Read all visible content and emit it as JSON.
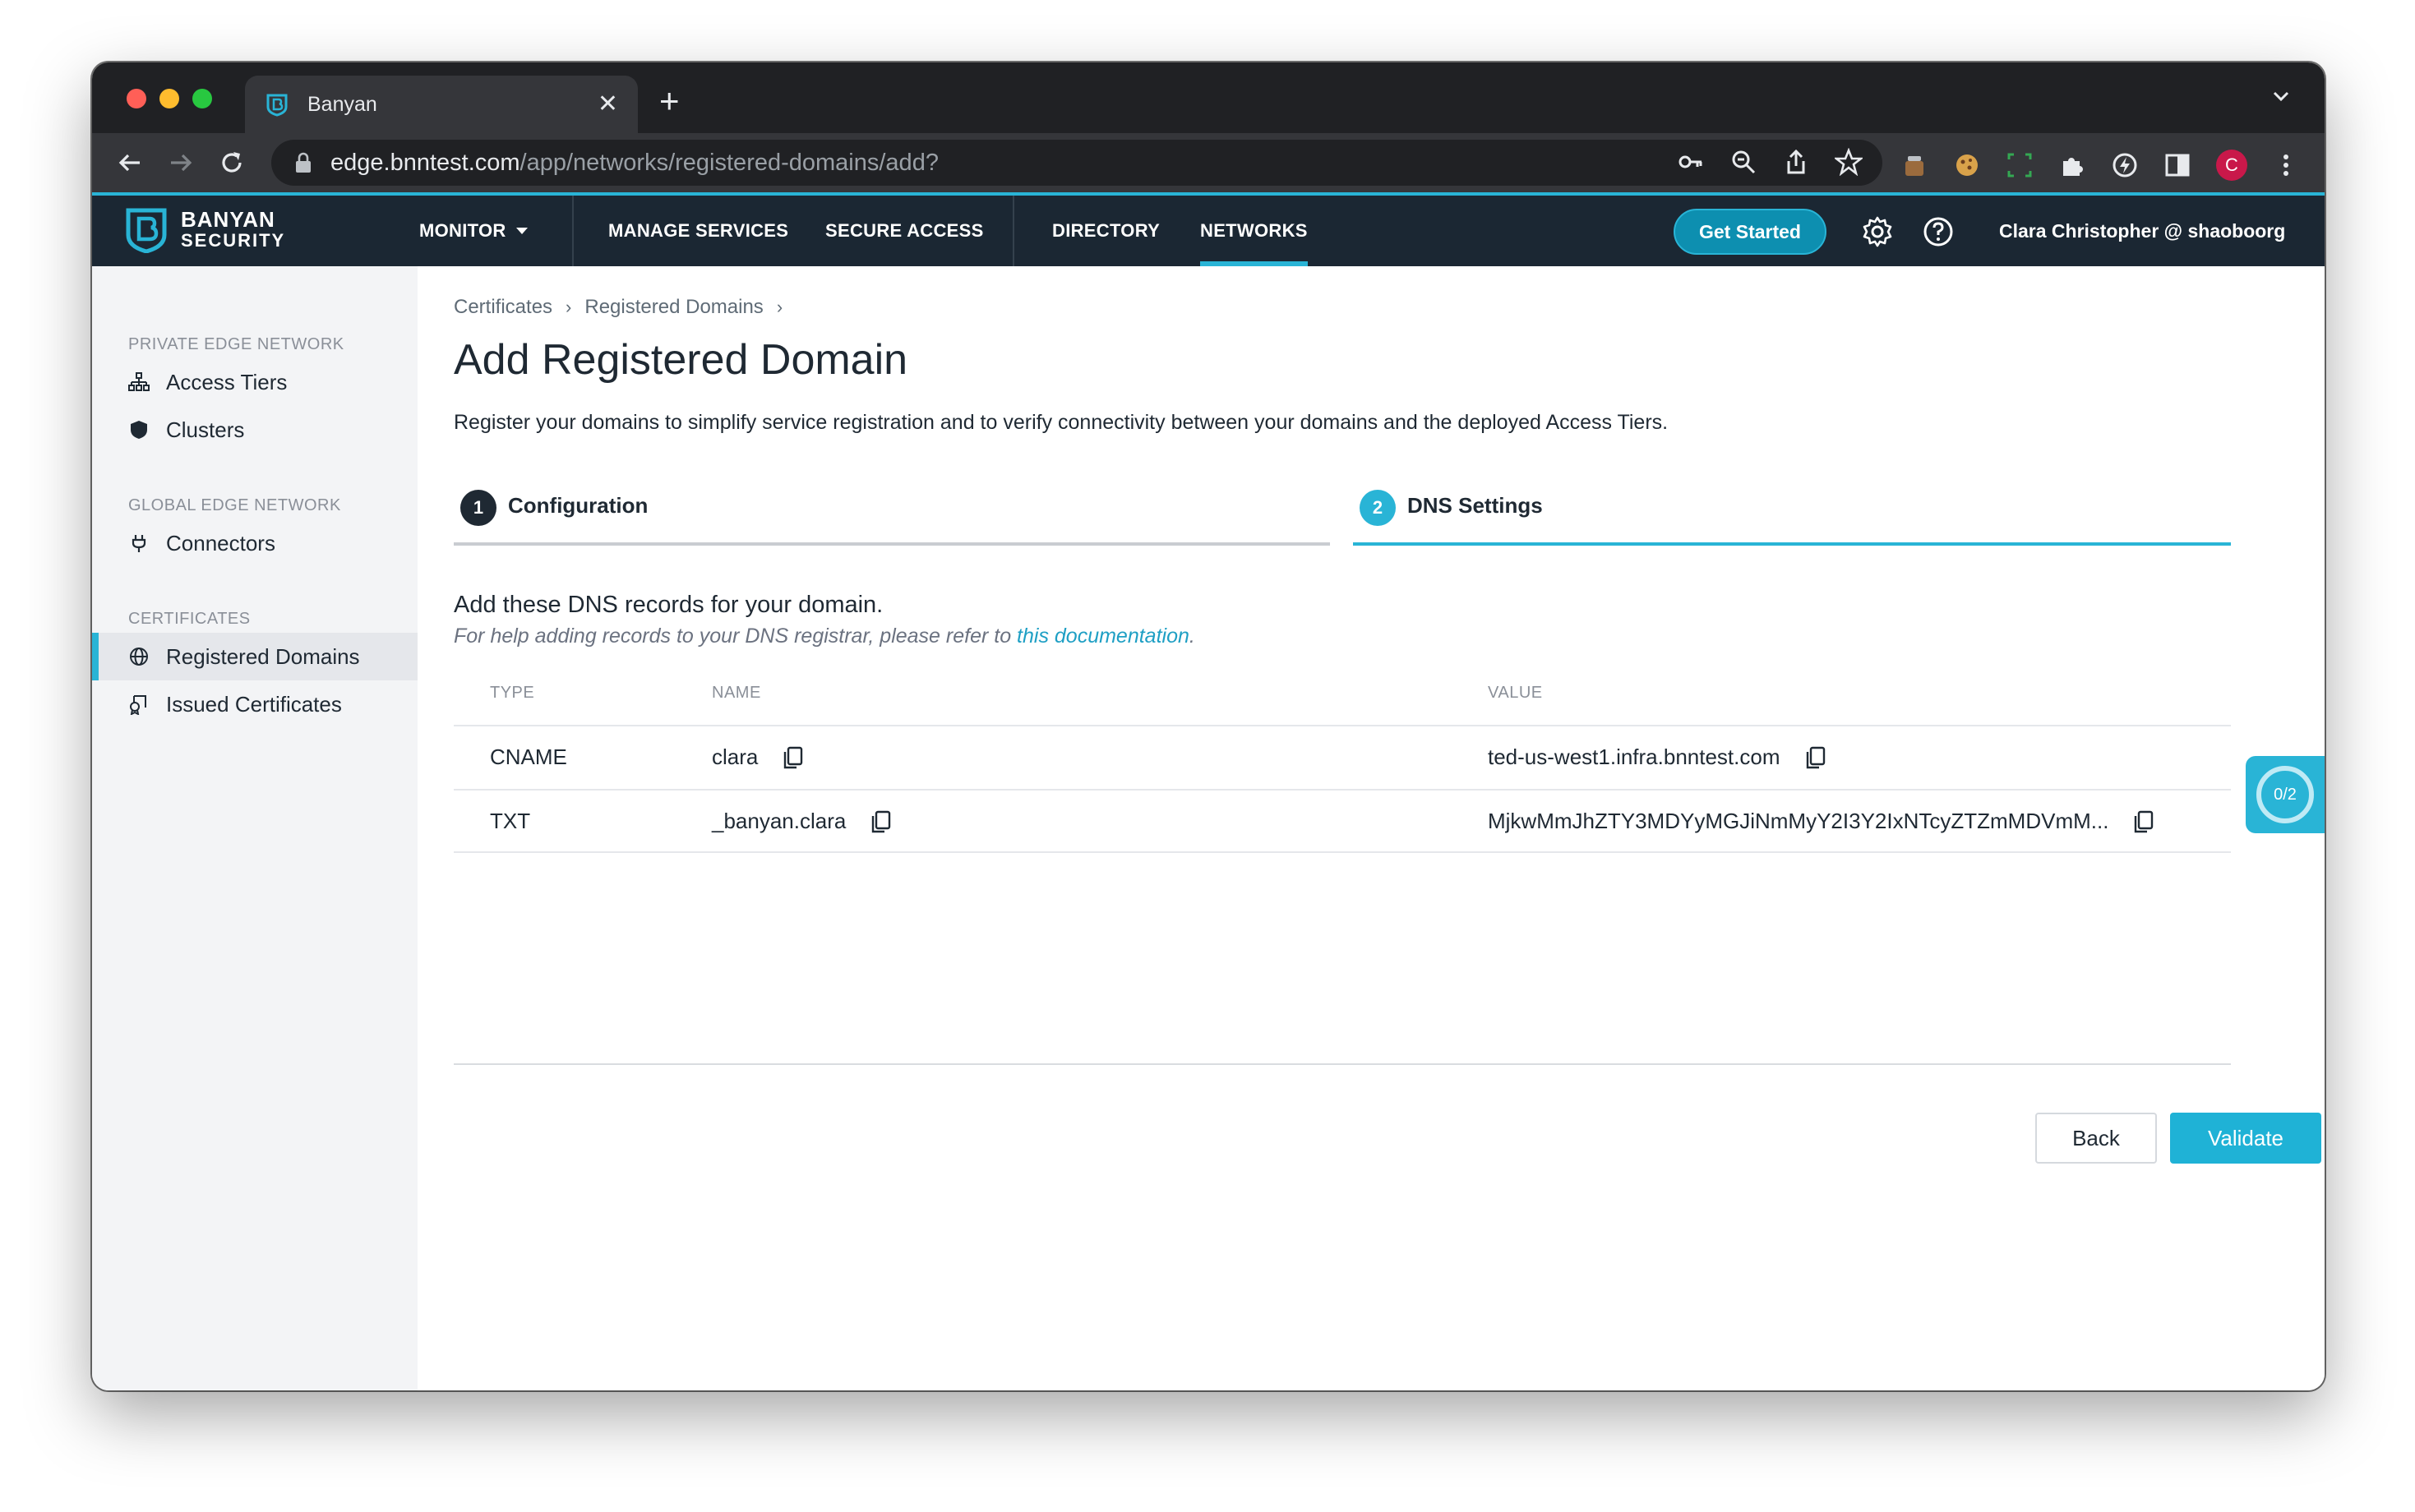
{
  "browser": {
    "tab_title": "Banyan",
    "url_host": "edge.bnntest.com",
    "url_path": "/app/networks/registered-domains/add?",
    "profile_initial": "C"
  },
  "header": {
    "logo_line1": "BANYAN",
    "logo_line2": "SECURITY",
    "nav": {
      "monitor": "MONITOR",
      "manage_services": "MANAGE SERVICES",
      "secure_access": "SECURE ACCESS",
      "directory": "DIRECTORY",
      "networks": "NETWORKS"
    },
    "get_started": "Get Started",
    "user": "Clara Christopher @ shaoboorg"
  },
  "sidebar": {
    "sections": [
      {
        "title": "PRIVATE EDGE NETWORK",
        "items": [
          {
            "label": "Access Tiers",
            "icon": "sitemap-icon"
          },
          {
            "label": "Clusters",
            "icon": "shield-icon"
          }
        ]
      },
      {
        "title": "GLOBAL EDGE NETWORK",
        "items": [
          {
            "label": "Connectors",
            "icon": "plug-icon"
          }
        ]
      },
      {
        "title": "CERTIFICATES",
        "items": [
          {
            "label": "Registered Domains",
            "icon": "globe-icon",
            "active": true
          },
          {
            "label": "Issued Certificates",
            "icon": "certificate-icon"
          }
        ]
      }
    ]
  },
  "main": {
    "breadcrumbs": [
      "Certificates",
      "Registered Domains"
    ],
    "title": "Add Registered Domain",
    "lead": "Register your domains to simplify service registration and to verify connectivity between your domains and the deployed Access Tiers.",
    "steps": [
      {
        "number": "1",
        "label": "Configuration"
      },
      {
        "number": "2",
        "label": "DNS Settings",
        "active": true
      }
    ],
    "dns_title": "Add these DNS records for your domain.",
    "dns_help_prefix": "For help adding records to your DNS registrar, please refer to ",
    "dns_help_link": "this documentation",
    "dns_help_suffix": ".",
    "table": {
      "headers": {
        "type": "TYPE",
        "name": "NAME",
        "value": "VALUE"
      },
      "rows": [
        {
          "type": "CNAME",
          "name": "clara",
          "value": "ted-us-west1.infra.bnntest.com"
        },
        {
          "type": "TXT",
          "name": "_banyan.clara",
          "value": "MjkwMmJhZTY3MDYyMGJiNmMyY2I3Y2IxNTcyZTZmMDVmM..."
        }
      ]
    },
    "buttons": {
      "back": "Back",
      "validate": "Validate"
    },
    "progress_badge": "0/2"
  },
  "colors": {
    "accent": "#29b4d6",
    "header_bg": "#1b2733",
    "primary_button": "#1fb2d6"
  }
}
